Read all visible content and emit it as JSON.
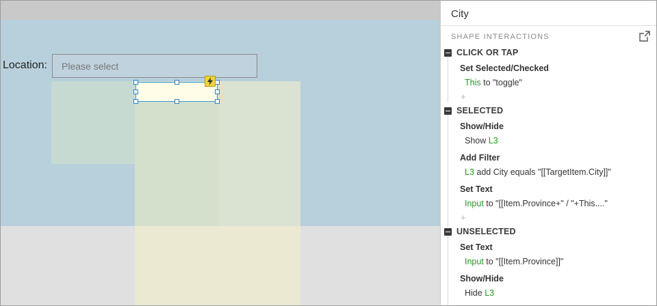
{
  "canvas": {
    "location_label": "Location:",
    "select_placeholder": "Please select"
  },
  "panel": {
    "title": "City",
    "section_label": "SHAPE INTERACTIONS",
    "events": [
      {
        "label": "CLICK OR TAP",
        "actions": [
          {
            "name": "Set Selected/Checked",
            "target": "This",
            "rest": " to \"toggle\""
          }
        ]
      },
      {
        "label": "SELECTED",
        "actions": [
          {
            "name": "Show/Hide",
            "prefix": "Show ",
            "target": "L3",
            "rest": ""
          },
          {
            "name": "Add Filter",
            "target": "L3",
            "rest": " add City equals \"[[TargetItem.City]]\""
          },
          {
            "name": "Set Text",
            "target": "Input",
            "rest": " to \"[[Item.Province+\" / \"+This....\""
          }
        ]
      },
      {
        "label": "UNSELECTED",
        "actions": [
          {
            "name": "Set Text",
            "target": "Input",
            "rest": " to \"[[Item.Province]]\""
          },
          {
            "name": "Show/Hide",
            "prefix": "Hide ",
            "target": "L3",
            "rest": ""
          }
        ]
      }
    ],
    "add_symbol": "+"
  },
  "colors": {
    "green_text": "#1f9a1f",
    "canvas_blue": "#b8d0dc",
    "selection_blue": "#3a9ad9",
    "bolt_yellow": "#f2d33a"
  },
  "icons": {
    "bolt": "lightning-bolt-icon",
    "popout": "external-link-icon",
    "collapse": "collapse-minus-icon"
  }
}
